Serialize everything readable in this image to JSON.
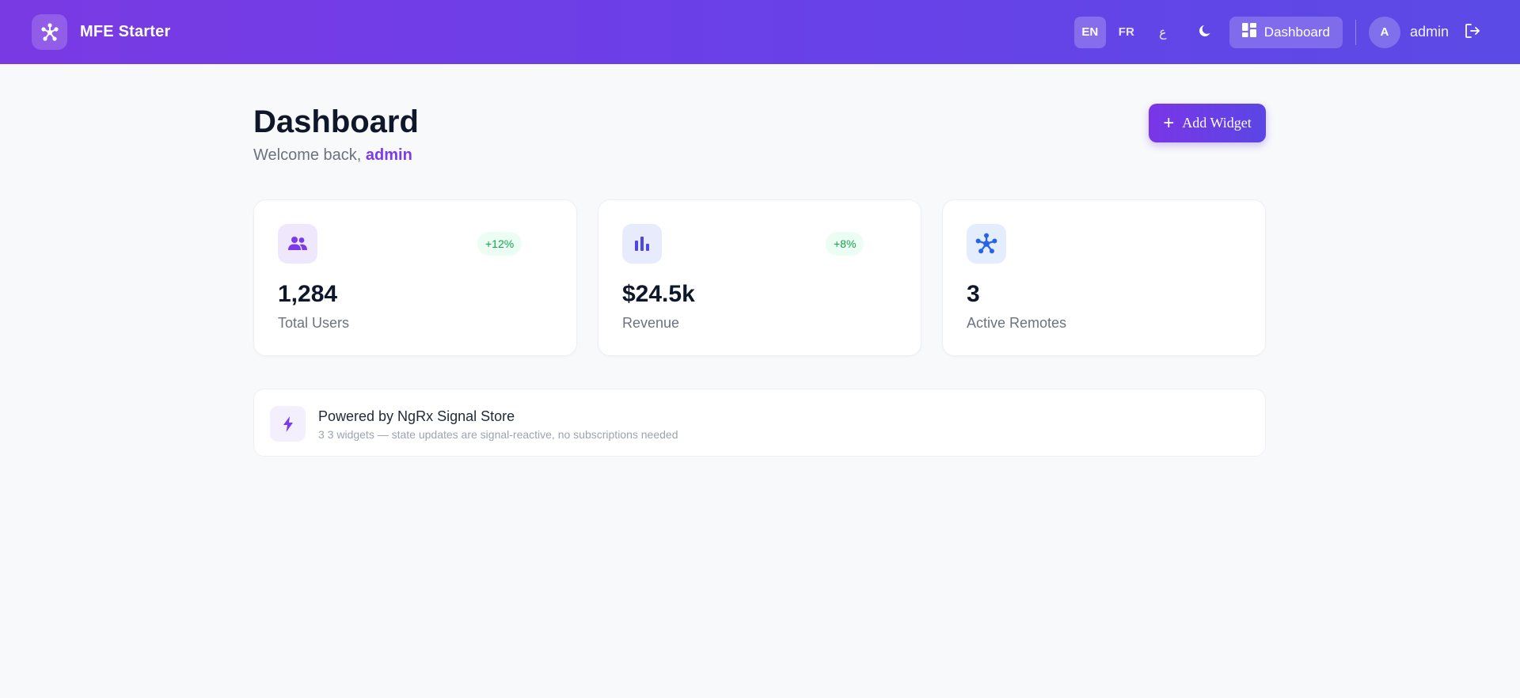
{
  "header": {
    "brand": "MFE Starter",
    "languages": [
      {
        "label": "EN",
        "active": true
      },
      {
        "label": "FR",
        "active": false
      },
      {
        "label": "ع",
        "active": false
      }
    ],
    "theme_icon": "moon-icon",
    "nav_label": "Dashboard",
    "avatar_initial": "A",
    "username": "admin",
    "logout_icon": "logout-icon"
  },
  "main": {
    "title": "Dashboard",
    "welcome_prefix": "Welcome back, ",
    "welcome_name": "admin",
    "add_widget_label": "Add Widget",
    "stats": [
      {
        "value": "1,284",
        "label": "Total Users",
        "badge": "+12%",
        "icon": "users-icon",
        "icon_bg": "#efe8fc",
        "icon_color": "#7c3aed"
      },
      {
        "value": "$24.5k",
        "label": "Revenue",
        "badge": "+8%",
        "icon": "bar-chart-icon",
        "icon_bg": "#e7ebfc",
        "icon_color": "#4f46e5"
      },
      {
        "value": "3",
        "label": "Active Remotes",
        "badge": "",
        "icon": "hub-icon",
        "icon_bg": "#e3edfd",
        "icon_color": "#2563eb"
      }
    ],
    "info": {
      "title": "Powered by NgRx Signal Store",
      "subtitle": "3 3 widgets — state updates are signal-reactive, no subscriptions needed",
      "icon": "bolt-icon"
    }
  },
  "colors": {
    "header_gradient_start": "#7a3ae3",
    "header_gradient_end": "#5b4ae6",
    "accent": "#7c3aed",
    "positive": "#16a34a",
    "background": "#f8f9fb"
  }
}
